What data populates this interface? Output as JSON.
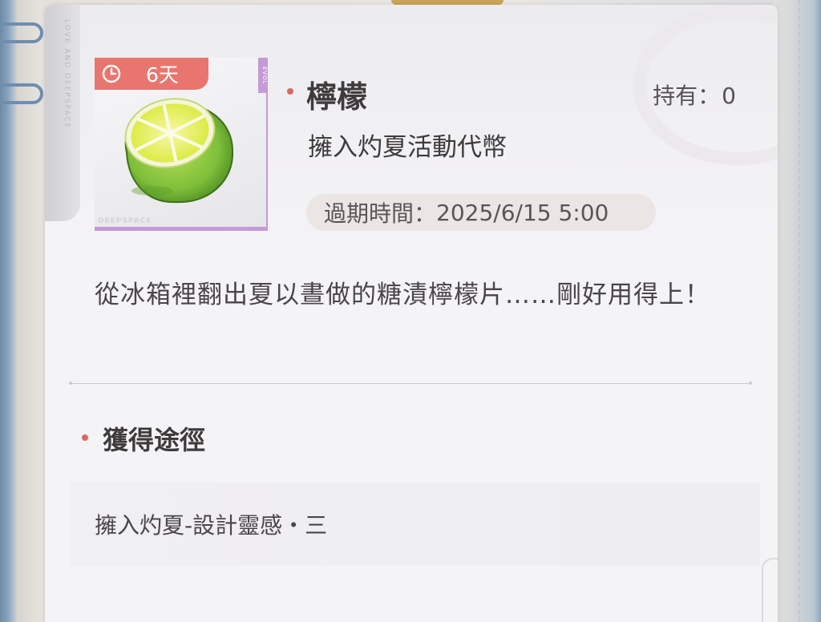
{
  "branding": {
    "vertical_text": "LOVE AND DEEPSPACE",
    "evol_tag": "EVOL",
    "watermark": "DEEPSPACE"
  },
  "item": {
    "timer_days": "6天",
    "name": "檸檬",
    "owned_label": "持有：",
    "owned_value": "0",
    "type": "擁入灼夏活動代幣",
    "expire_label": "過期時間：",
    "expire_value": "2025/6/15 5:00",
    "description": "從冰箱裡翻出夏以晝做的糖漬檸檬片……剛好用得上！"
  },
  "acquisition": {
    "title": "獲得途徑",
    "sources": [
      {
        "label": "擁入灼夏-設計靈感・三"
      }
    ]
  },
  "colors": {
    "accent_dot": "#d9695f",
    "timer_badge": "#e8766f",
    "rarity_border": "#c59ad6"
  },
  "icons": {
    "timer": "clock-icon",
    "item": "lemon-icon"
  }
}
